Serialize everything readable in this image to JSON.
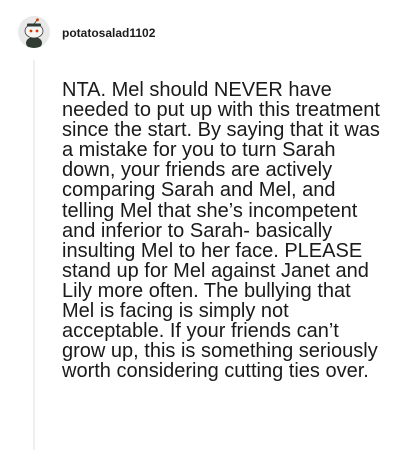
{
  "comment": {
    "username": "potatosalad1102",
    "avatar_icon": "snoo-avatar-icon",
    "body": "NTA. Mel should NEVER have needed to put up with this treatment since the start. By saying that it was a mistake for you to turn Sarah down, your friends are actively comparing Sarah and Mel, and telling Mel that she’s incompetent and inferior to Sarah- basically insulting Mel to her face. PLEASE stand up for Mel against Janet and Lily more often. The bullying that Mel is facing is simply not acceptable. If your friends can’t grow up, this is something seriously worth considering cutting ties over."
  }
}
